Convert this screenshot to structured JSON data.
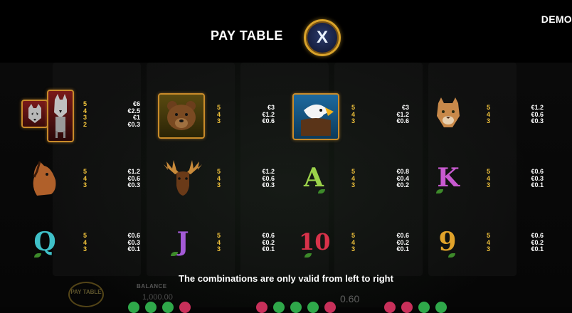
{
  "header": {
    "title": "PAY TABLE",
    "close_label": "X",
    "demo_label": "DEMO"
  },
  "symbols": [
    {
      "name": "wolf",
      "icon": "wolf-icon",
      "counts": [
        "5",
        "4",
        "3",
        "2"
      ],
      "payouts": [
        "€6",
        "€2.5",
        "€1",
        "€0.3"
      ]
    },
    {
      "name": "bear",
      "icon": "bear-icon",
      "counts": [
        "5",
        "4",
        "3"
      ],
      "payouts": [
        "€3",
        "€1.2",
        "€0.6"
      ]
    },
    {
      "name": "eagle",
      "icon": "eagle-icon",
      "counts": [
        "5",
        "4",
        "3"
      ],
      "payouts": [
        "€3",
        "€1.2",
        "€0.6"
      ]
    },
    {
      "name": "puma",
      "icon": "puma-icon",
      "counts": [
        "5",
        "4",
        "3"
      ],
      "payouts": [
        "€1.2",
        "€0.6",
        "€0.3"
      ]
    },
    {
      "name": "horse",
      "icon": "horse-icon",
      "counts": [
        "5",
        "4",
        "3"
      ],
      "payouts": [
        "€1.2",
        "€0.6",
        "€0.3"
      ]
    },
    {
      "name": "moose",
      "icon": "moose-icon",
      "counts": [
        "5",
        "4",
        "3"
      ],
      "payouts": [
        "€1.2",
        "€0.6",
        "€0.3"
      ]
    },
    {
      "name": "A",
      "icon": "letter-a-icon",
      "letter": "A",
      "color": "#9bd24a",
      "counts": [
        "5",
        "4",
        "3"
      ],
      "payouts": [
        "€0.8",
        "€0.4",
        "€0.2"
      ]
    },
    {
      "name": "K",
      "icon": "letter-k-icon",
      "letter": "K",
      "color": "#c85ad0",
      "counts": [
        "5",
        "4",
        "3"
      ],
      "payouts": [
        "€0.6",
        "€0.3",
        "€0.1"
      ]
    },
    {
      "name": "Q",
      "icon": "letter-q-icon",
      "letter": "Q",
      "color": "#3fc0c8",
      "counts": [
        "5",
        "4",
        "3"
      ],
      "payouts": [
        "€0.6",
        "€0.3",
        "€0.1"
      ]
    },
    {
      "name": "J",
      "icon": "letter-j-icon",
      "letter": "J",
      "color": "#a35ad6",
      "counts": [
        "5",
        "4",
        "3"
      ],
      "payouts": [
        "€0.6",
        "€0.2",
        "€0.1"
      ]
    },
    {
      "name": "10",
      "icon": "letter-10-icon",
      "letter": "10",
      "color": "#d8324a",
      "counts": [
        "5",
        "4",
        "3"
      ],
      "payouts": [
        "€0.6",
        "€0.2",
        "€0.1"
      ]
    },
    {
      "name": "9",
      "icon": "letter-9-icon",
      "letter": "9",
      "color": "#e0a22a",
      "counts": [
        "5",
        "4",
        "3"
      ],
      "payouts": [
        "€0.6",
        "€0.2",
        "€0.1"
      ]
    }
  ],
  "footer": {
    "note": "The combinations are only valid from left to right",
    "paytable_button": "PAY TABLE",
    "balance_label": "BALANCE",
    "balance_value": "1,000.00",
    "bet_value": "0.60"
  },
  "colors": {
    "count_color": "#f2c33b",
    "close_border": "#d9a32a"
  }
}
